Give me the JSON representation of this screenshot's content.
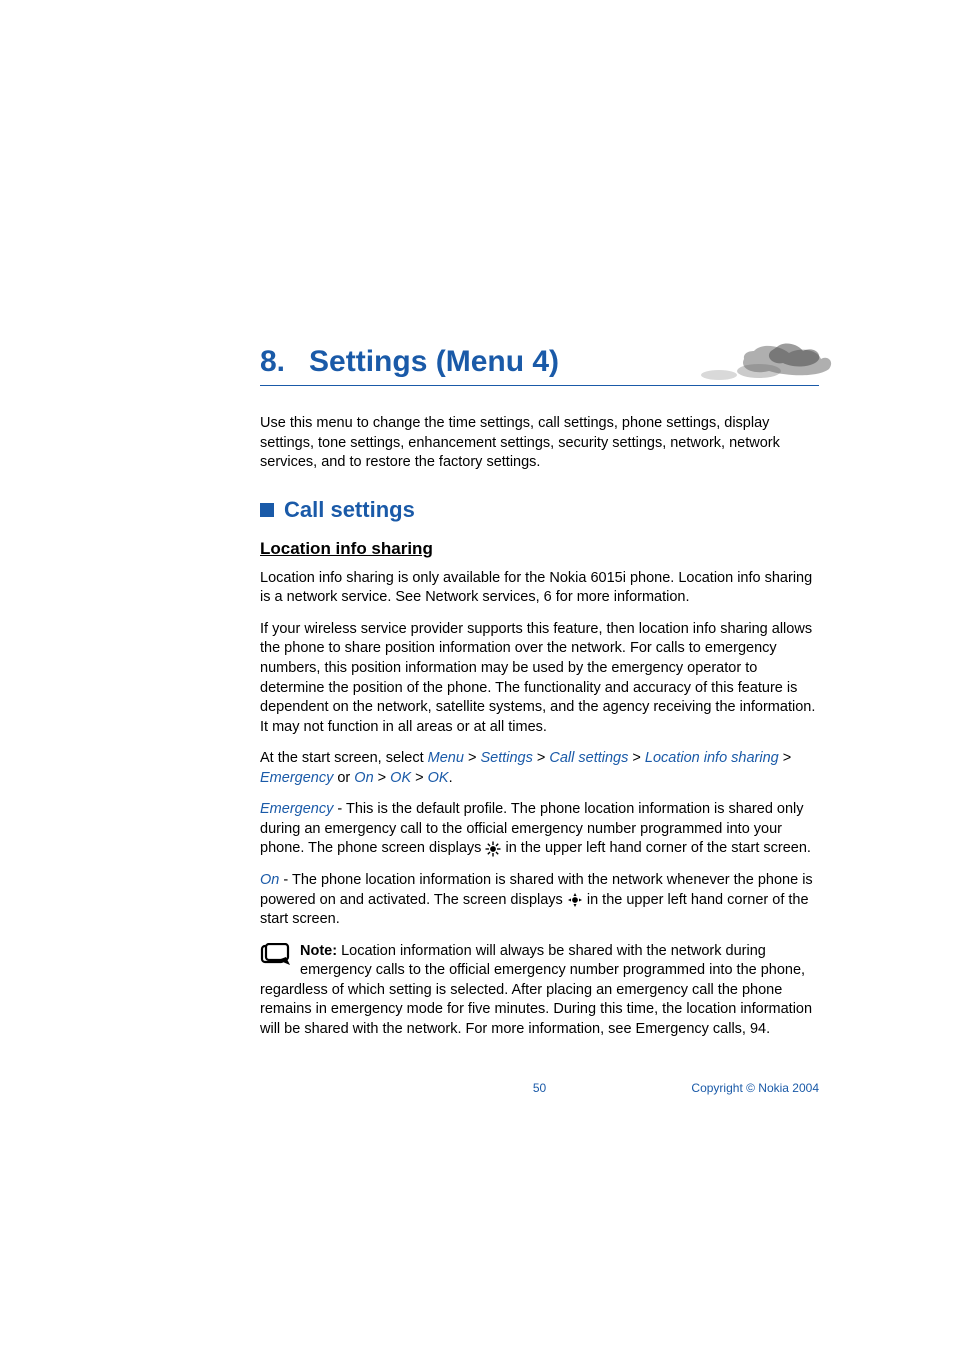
{
  "chapter": {
    "number": "8.",
    "title": "Settings (Menu 4)"
  },
  "intro": "Use this menu to change the time settings, call settings, phone settings, display settings, tone settings, enhancement settings, security settings, network, network services, and to restore the factory settings.",
  "section": {
    "title": "Call settings"
  },
  "subsection": {
    "title": "Location info sharing"
  },
  "p1": "Location info sharing is only available for the Nokia 6015i phone. Location info sharing is a network service. See Network services, 6 for more information.",
  "p2": "If your wireless service provider supports this feature, then location info sharing allows the phone to share position information over the network. For calls to emergency numbers, this position information may be used by the emergency operator to determine the position of the phone. The functionality and accuracy of this feature is dependent on the network, satellite systems, and the agency receiving the information. It may not function in all areas or at all times.",
  "nav": {
    "prefix": "At the start screen, select ",
    "menu": "Menu",
    "settings": "Settings",
    "callsettings": "Call settings",
    "location": "Location info sharing",
    "emergency": "Emergency",
    "or": " or ",
    "on": "On",
    "ok1": "OK",
    "ok2": "OK",
    "gt": " > "
  },
  "emergency": {
    "label": "Emergency",
    "text_a": " - This is the default profile. The phone location information is shared only during an emergency call to the official emergency number programmed into your phone. The phone screen displays ",
    "text_b": " in the upper left hand corner of the start screen."
  },
  "on": {
    "label": "On",
    "text_a": " - The phone location information is shared with the network whenever the phone is powered on and activated. The screen displays ",
    "text_b": " in the upper left hand corner of the start screen."
  },
  "note": {
    "label": "Note:",
    "text": " Location information will always be shared with the network during emergency calls to the official emergency number programmed into the phone, regardless of which setting is selected. After placing an emergency call the phone remains in emergency mode for five minutes. During this time, the location information will be shared with the network. For more information, see Emergency calls, 94."
  },
  "footer": {
    "page": "50",
    "copyright": "Copyright © Nokia 2004"
  }
}
